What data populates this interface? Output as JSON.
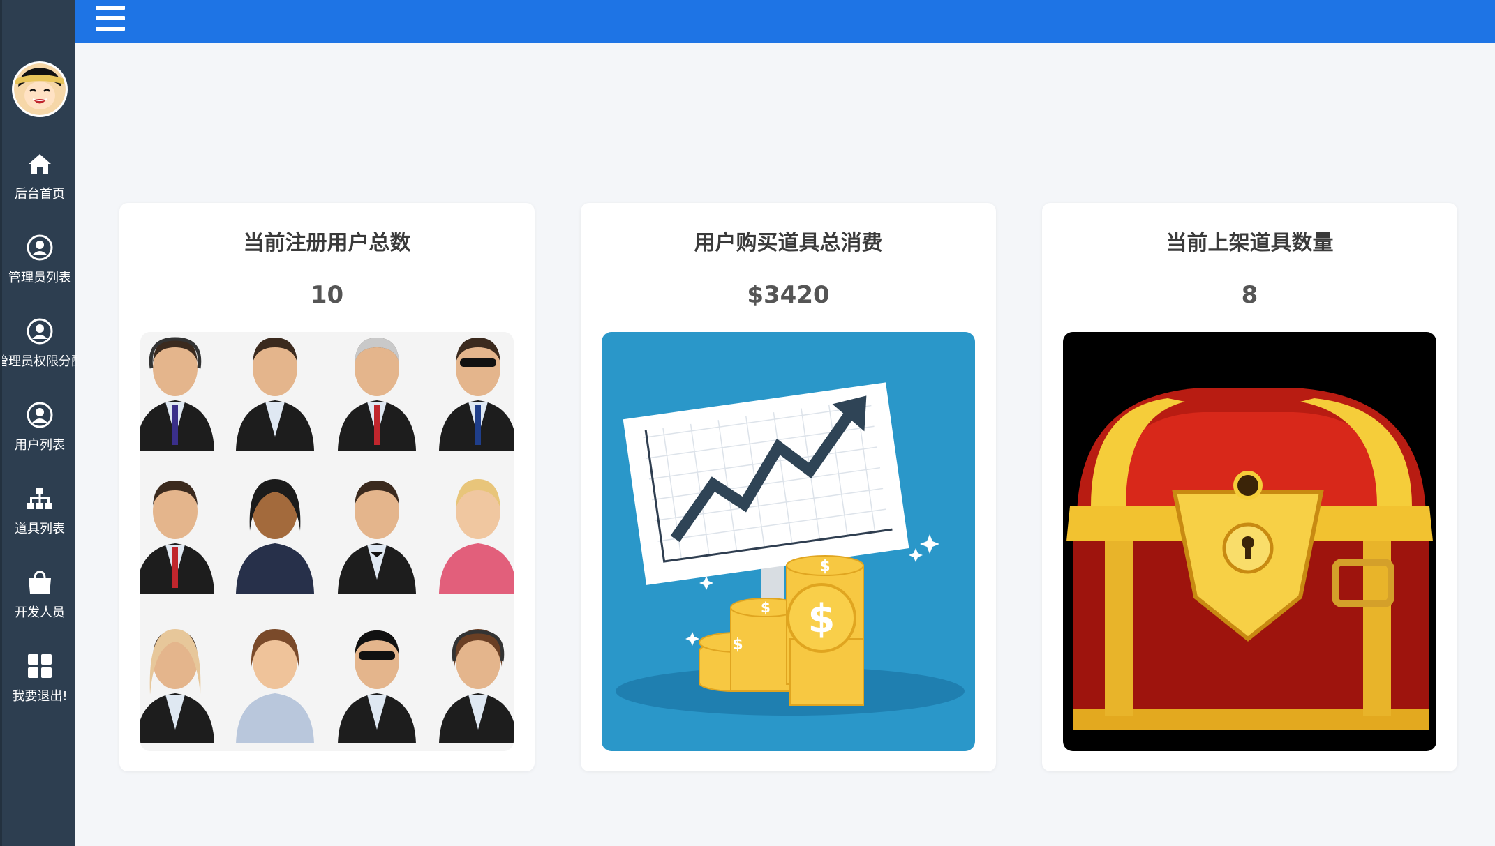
{
  "sidebar": {
    "items": [
      {
        "icon": "home-icon",
        "label": "后台首页"
      },
      {
        "icon": "user-circle-icon",
        "label": "管理员列表"
      },
      {
        "icon": "user-circle-icon",
        "label": "管理员权限分配"
      },
      {
        "icon": "user-circle-icon",
        "label": "用户列表"
      },
      {
        "icon": "sitemap-icon",
        "label": "道具列表"
      },
      {
        "icon": "shopping-bag-icon",
        "label": "开发人员"
      },
      {
        "icon": "grid-icon",
        "label": "我要退出!"
      }
    ]
  },
  "topbar": {
    "menu_icon": "hamburger-menu-icon",
    "color": "#1e74e5"
  },
  "cards": [
    {
      "title": "当前注册用户总数",
      "value": "10",
      "image": "user-avatars-grid"
    },
    {
      "title": "用户购买道具总消费",
      "value": "$3420",
      "image": "rising-chart-with-coins"
    },
    {
      "title": "当前上架道具数量",
      "value": "8",
      "image": "treasure-chest"
    }
  ],
  "colors": {
    "sidebar": "#2d3e50",
    "background": "#f4f6f9",
    "card": "#ffffff"
  }
}
